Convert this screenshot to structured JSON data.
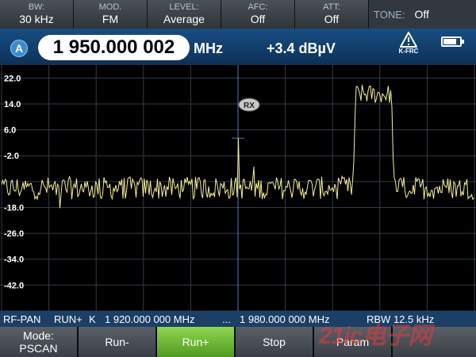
{
  "params": [
    {
      "label": "BW:",
      "value": "30 kHz"
    },
    {
      "label": "MOD.",
      "value": "FM"
    },
    {
      "label": "LEVEL:",
      "value": "Average"
    },
    {
      "label": "AFC:",
      "value": "Off"
    },
    {
      "label": "ATT:",
      "value": "Off"
    }
  ],
  "tone": {
    "label": "TONE:",
    "value": "Off"
  },
  "channel": "A",
  "frequency": "1 950.000 002",
  "frequency_unit": "MHz",
  "level": "+3.4 dBµV",
  "warning_label": "K-FRC",
  "battery_level": 0.8,
  "marker_label": "RX",
  "status": {
    "mode": "RF-PAN",
    "run": "RUN+",
    "k": "K",
    "start": "1 920.000 000 MHz",
    "sep": "...",
    "stop": "1 980.000 000 MHz",
    "rbw": "RBW 12.5 kHz"
  },
  "softkeys": [
    {
      "line1": "Mode:",
      "line2": "PSCAN",
      "active": false
    },
    {
      "line1": "Run-",
      "line2": "",
      "active": false
    },
    {
      "line1": "Run+",
      "line2": "",
      "active": true
    },
    {
      "line1": "Stop",
      "line2": "",
      "active": false
    },
    {
      "line1": "Param",
      "line2": "",
      "active": false
    },
    {
      "line1": "",
      "line2": "",
      "active": false
    }
  ],
  "watermark": "21ic电子网",
  "colors": {
    "trace": "#f4ef9a",
    "grid": "#343a46",
    "marker_line": "#5b79b6"
  },
  "chart_data": {
    "type": "line",
    "xlim": [
      1920.0,
      1980.0
    ],
    "ylim": [
      -50.0,
      26.0
    ],
    "y_ticks": [
      22.0,
      14.0,
      6.0,
      -2.0,
      -18.0,
      -26.0,
      -34.0,
      -42.0
    ],
    "y_tick_labels": [
      "22.0",
      "14.0",
      "6.0",
      "-2.0",
      "-18.0",
      "-26.0",
      "-34.0",
      "-42.0"
    ],
    "noise_floor_dbuv": -12.0,
    "marker_freq_mhz": 1950.0,
    "marker_level_dbuv": 3.4,
    "signal_band_mhz": [
      1964.6,
      1969.8
    ],
    "signal_peak_dbuv": 19.0
  }
}
